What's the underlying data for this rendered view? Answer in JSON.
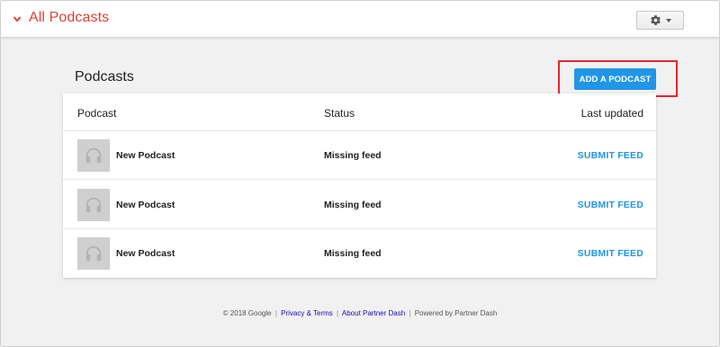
{
  "header": {
    "nav_title": "All Podcasts"
  },
  "main": {
    "title": "Podcasts",
    "add_button_label": "ADD A PODCAST",
    "table": {
      "columns": [
        "Podcast",
        "Status",
        "Last updated"
      ],
      "rows": [
        {
          "name": "New Podcast",
          "status": "Missing feed",
          "action": "SUBMIT FEED"
        },
        {
          "name": "New Podcast",
          "status": "Missing feed",
          "action": "SUBMIT FEED"
        },
        {
          "name": "New Podcast",
          "status": "Missing feed",
          "action": "SUBMIT FEED"
        }
      ]
    }
  },
  "footer": {
    "copyright": "© 2018 Google",
    "privacy_link": "Privacy & Terms",
    "about_link": "About Partner Dash",
    "powered_by": "Powered by Partner Dash"
  },
  "icons": {
    "nav_chevron": "chevron-down-icon",
    "settings": "gear-icon",
    "thumbnail": "headphones-icon"
  },
  "colors": {
    "accent_red": "#db4437",
    "primary_blue": "#2196e6",
    "highlight_red": "#e8262d"
  }
}
